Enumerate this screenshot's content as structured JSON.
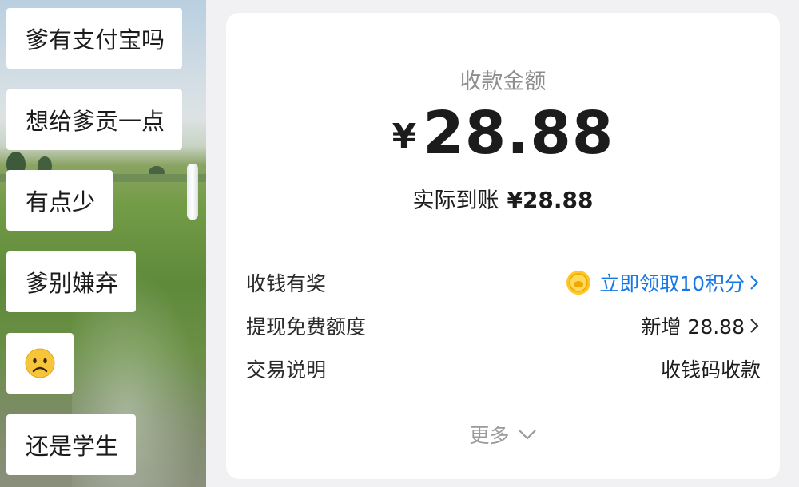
{
  "chat": {
    "messages": [
      {
        "text": "爹有支付宝吗"
      },
      {
        "text": "想给爹贡一点"
      },
      {
        "text": "有点少"
      },
      {
        "text": "爹别嫌弃"
      },
      {
        "text": "",
        "icon": "frowning-face-emoji"
      },
      {
        "text": "还是学生"
      }
    ]
  },
  "receipt": {
    "amount_title": "收款金额",
    "currency_symbol": "¥",
    "amount": "28.88",
    "received_label": "实际到账",
    "received_value": "¥28.88",
    "rows": [
      {
        "label": "收钱有奖",
        "value": "立即领取10积分",
        "icon": "coin-icon",
        "color": "#1677e6"
      },
      {
        "label": "提现免费额度",
        "value": "新增 28.88"
      },
      {
        "label": "交易说明",
        "value": "收钱码收款"
      }
    ],
    "more_label": "更多"
  },
  "colors": {
    "link": "#1677e6",
    "background": "#f1f1f3"
  }
}
